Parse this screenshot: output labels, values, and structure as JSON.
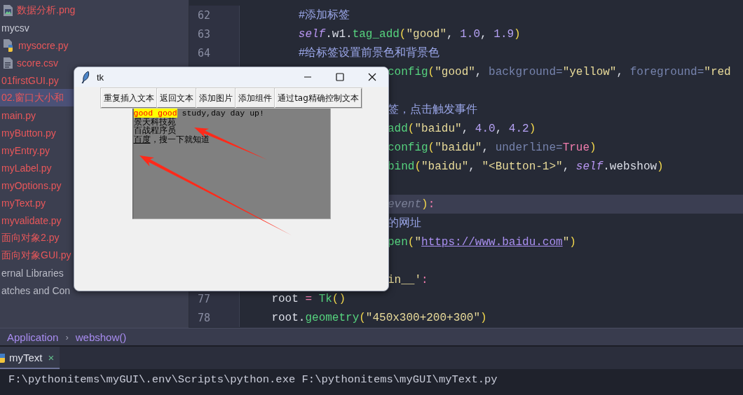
{
  "project_tree": [
    {
      "label": "数据分析.png",
      "kind": "image-file",
      "color": "#e8575a",
      "selected": false
    },
    {
      "label": "mycsv",
      "kind": "plain",
      "color": "#c9cbd6",
      "selected": false
    },
    {
      "label": "mysocre.py",
      "kind": "python-file",
      "color": "#e8575a",
      "selected": false
    },
    {
      "label": "score.csv",
      "kind": "text-file",
      "color": "#e8575a",
      "selected": false
    },
    {
      "label": "01firstGUI.py",
      "kind": "plain",
      "color": "#e8575a",
      "selected": false
    },
    {
      "label": "02.窗口大小和",
      "kind": "plain",
      "color": "#e8575a",
      "selected": true
    },
    {
      "label": "main.py",
      "kind": "plain",
      "color": "#e8575a",
      "selected": false
    },
    {
      "label": "myButton.py",
      "kind": "plain",
      "color": "#e8575a",
      "selected": false
    },
    {
      "label": "myEntry.py",
      "kind": "plain",
      "color": "#e8575a",
      "selected": false
    },
    {
      "label": "myLabel.py",
      "kind": "plain",
      "color": "#e8575a",
      "selected": false
    },
    {
      "label": "myOptions.py",
      "kind": "plain",
      "color": "#e8575a",
      "selected": false
    },
    {
      "label": "myText.py",
      "kind": "plain",
      "color": "#e8575a",
      "selected": false
    },
    {
      "label": "myvalidate.py",
      "kind": "plain",
      "color": "#e8575a",
      "selected": false
    },
    {
      "label": "面向对象2.py",
      "kind": "plain",
      "color": "#e8575a",
      "selected": false
    },
    {
      "label": "面向对象GUI.py",
      "kind": "plain",
      "color": "#e8575a",
      "selected": false
    },
    {
      "label": "ernal Libraries",
      "kind": "plain",
      "color": "#b9bbc6",
      "selected": false
    },
    {
      "label": "atches and Con",
      "kind": "plain",
      "color": "#b9bbc6",
      "selected": false
    }
  ],
  "editor": {
    "lines": [
      {
        "number": "62",
        "kind": "code",
        "tokens": [
          {
            "t": "        #添加标签",
            "kind": "comment"
          }
        ]
      },
      {
        "number": "63",
        "kind": "code",
        "tokens": [
          {
            "t": "        self",
            "kind": "self"
          },
          {
            "t": ".w1.",
            "kind": "plain"
          },
          {
            "t": "tag_add",
            "kind": "func"
          },
          {
            "t": "(",
            "kind": "paren"
          },
          {
            "t": "\"good\"",
            "kind": "str"
          },
          {
            "t": ", ",
            "kind": "plain"
          },
          {
            "t": "1.0",
            "kind": "num"
          },
          {
            "t": ", ",
            "kind": "plain"
          },
          {
            "t": "1.9",
            "kind": "num"
          },
          {
            "t": ")",
            "kind": "paren"
          }
        ]
      },
      {
        "number": "64",
        "kind": "code",
        "tokens": [
          {
            "t": "        #给标签设置前景色和背景色",
            "kind": "comment"
          }
        ]
      },
      {
        "kind": "clipped",
        "tokens": [
          {
            "t": "config",
            "kind": "func"
          },
          {
            "t": "(",
            "kind": "paren"
          },
          {
            "t": "\"good\"",
            "kind": "str"
          },
          {
            "t": ", ",
            "kind": "plain"
          },
          {
            "t": "background=",
            "kind": "param"
          },
          {
            "t": "\"yellow\"",
            "kind": "str"
          },
          {
            "t": ", ",
            "kind": "plain"
          },
          {
            "t": "foreground=",
            "kind": "param"
          },
          {
            "t": "\"red",
            "kind": "str"
          }
        ]
      },
      {
        "kind": "blank"
      },
      {
        "kind": "clipped",
        "tokens": [
          {
            "t": "签，点击触发事件",
            "kind": "comment"
          }
        ]
      },
      {
        "kind": "clipped",
        "tokens": [
          {
            "t": "add",
            "kind": "func"
          },
          {
            "t": "(",
            "kind": "paren"
          },
          {
            "t": "\"baidu\"",
            "kind": "str"
          },
          {
            "t": ", ",
            "kind": "plain"
          },
          {
            "t": "4.0",
            "kind": "num"
          },
          {
            "t": ", ",
            "kind": "plain"
          },
          {
            "t": "4.2",
            "kind": "num"
          },
          {
            "t": ")",
            "kind": "paren"
          }
        ]
      },
      {
        "kind": "clipped",
        "tokens": [
          {
            "t": "config",
            "kind": "func"
          },
          {
            "t": "(",
            "kind": "paren"
          },
          {
            "t": "\"baidu\"",
            "kind": "str"
          },
          {
            "t": ", ",
            "kind": "plain"
          },
          {
            "t": "underline=",
            "kind": "param"
          },
          {
            "t": "True",
            "kind": "kw"
          },
          {
            "t": ")",
            "kind": "paren"
          }
        ]
      },
      {
        "kind": "clipped",
        "tokens": [
          {
            "t": "bind",
            "kind": "func"
          },
          {
            "t": "(",
            "kind": "paren"
          },
          {
            "t": "\"baidu\"",
            "kind": "str"
          },
          {
            "t": ", ",
            "kind": "plain"
          },
          {
            "t": "\"<Button-1>\"",
            "kind": "str"
          },
          {
            "t": ", ",
            "kind": "plain"
          },
          {
            "t": "self",
            "kind": "self"
          },
          {
            "t": ".webshow",
            "kind": "plain"
          },
          {
            "t": ")",
            "kind": "paren"
          }
        ]
      },
      {
        "kind": "blank"
      },
      {
        "kind": "current",
        "tokens": [
          {
            "t": "event",
            "kind": "hint"
          },
          {
            "t": ")",
            "kind": "paren"
          },
          {
            "t": ":",
            "kind": "kw"
          }
        ]
      },
      {
        "kind": "clipped",
        "tokens": [
          {
            "t": "的网址",
            "kind": "comment"
          }
        ]
      },
      {
        "kind": "clipped",
        "tokens": [
          {
            "t": "pen",
            "kind": "func"
          },
          {
            "t": "(",
            "kind": "paren"
          },
          {
            "t": "\"",
            "kind": "str"
          },
          {
            "t": "https://www.baidu.com",
            "kind": "url"
          },
          {
            "t": "\"",
            "kind": "str"
          },
          {
            "t": ")",
            "kind": "paren"
          }
        ]
      },
      {
        "kind": "blank"
      },
      {
        "kind": "clipped",
        "tokens": [
          {
            "t": "in__'",
            "kind": "str"
          },
          {
            "t": ":",
            "kind": "kw"
          }
        ]
      },
      {
        "number": "77",
        "kind": "code",
        "tokens": [
          {
            "t": "    root ",
            "kind": "plain"
          },
          {
            "t": "= ",
            "kind": "kw"
          },
          {
            "t": "Tk",
            "kind": "func"
          },
          {
            "t": "()",
            "kind": "paren"
          }
        ]
      },
      {
        "number": "78",
        "kind": "code",
        "tokens": [
          {
            "t": "    root.",
            "kind": "plain"
          },
          {
            "t": "geometry",
            "kind": "func"
          },
          {
            "t": "(",
            "kind": "paren"
          },
          {
            "t": "\"450x300+200+300\"",
            "kind": "str"
          },
          {
            "t": ")",
            "kind": "paren"
          }
        ]
      }
    ]
  },
  "breadcrumb": {
    "items": [
      "Application",
      "webshow()"
    ],
    "separator": "›"
  },
  "run_panel": {
    "tab": {
      "label": "myText",
      "close": "×",
      "selected": true
    },
    "output": "F:\\pythonitems\\myGUI\\.env\\Scripts\\python.exe F:\\pythonitems\\myGUI\\myText.py"
  },
  "tk_window": {
    "title": "tk",
    "buttons": [
      "重复插入文本",
      "返回文本",
      "添加图片",
      "添加组件",
      "通过tag精确控制文本"
    ],
    "text_lines": [
      [
        {
          "t": "good good",
          "kind": "tagged"
        },
        {
          "t": " study,day day up!",
          "kind": "plain"
        }
      ],
      [
        {
          "t": "景天科技苑",
          "kind": "plain"
        }
      ],
      [
        {
          "t": "百战程序员",
          "kind": "plain"
        }
      ],
      [
        {
          "t": "百度",
          "kind": "link"
        },
        {
          "t": "，搜一下就知道",
          "kind": "plain"
        }
      ]
    ]
  },
  "annotations": [
    {
      "kind": "arrow"
    },
    {
      "kind": "arrow"
    }
  ]
}
